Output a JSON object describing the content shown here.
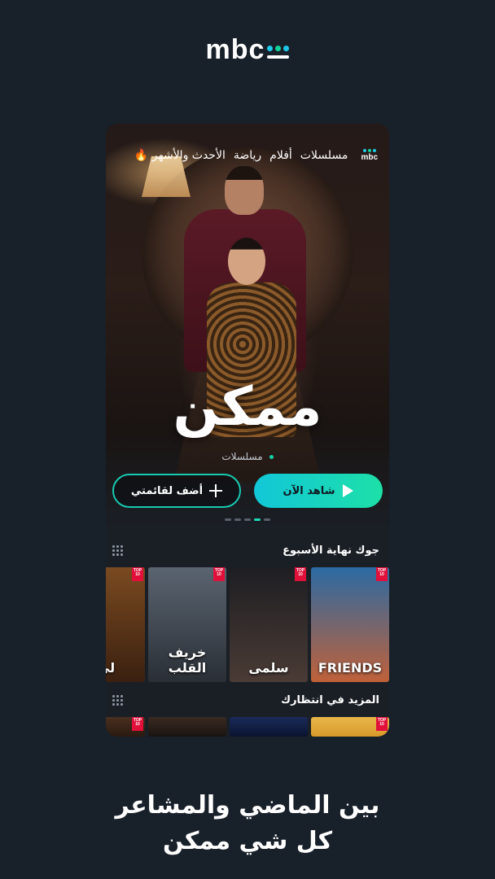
{
  "brand": {
    "logo": "mbc",
    "dot_colors": [
      "#1ec9e8",
      "#12d39c",
      "#1ec9e8",
      "#12d39c",
      "#1ec9e8",
      "#12d39c"
    ]
  },
  "nav": {
    "items": [
      "مسلسلات",
      "أفلام",
      "رياضة",
      "الأحدث والأشهر"
    ],
    "trending_icon": "fire-icon"
  },
  "hero": {
    "title": "ممكن",
    "genre": "مسلسلات",
    "watch_label": "شاهد الآن",
    "add_label": "أضف لقائمتي",
    "pager": {
      "count": 5,
      "active_index": 3
    }
  },
  "sections": [
    {
      "title": "جوك نهاية الأسبوع",
      "posters": [
        {
          "title": "FRIENDS",
          "badge": "TOP 10",
          "colors": [
            "#2b6aa3",
            "#c0613a"
          ]
        },
        {
          "title": "سلمى",
          "badge": "TOP 10",
          "colors": [
            "#1e1e22",
            "#4a3b35"
          ]
        },
        {
          "title": "خريف القلب",
          "badge": "TOP 10",
          "colors": [
            "#5a6470",
            "#2a2f36"
          ]
        },
        {
          "title": "لي",
          "badge": "TOP 10",
          "colors": [
            "#7a4a20",
            "#3a2010"
          ]
        }
      ]
    },
    {
      "title": "المزيد في انتظارك",
      "posters": [
        {
          "title": "",
          "badge": "TOP 10",
          "colors": [
            "#e8b64a",
            "#d89a2a"
          ]
        },
        {
          "title": "",
          "badge": "",
          "colors": [
            "#1a2a5a",
            "#0a1430"
          ]
        },
        {
          "title": "",
          "badge": "",
          "colors": [
            "#3a2a22",
            "#1a1410"
          ]
        },
        {
          "title": "",
          "badge": "TOP 10",
          "colors": [
            "#4a3020",
            "#2a1a10"
          ]
        }
      ]
    }
  ],
  "headline": {
    "line1": "بين الماضي والمشاعر",
    "line2": "كل شي ممكن"
  }
}
